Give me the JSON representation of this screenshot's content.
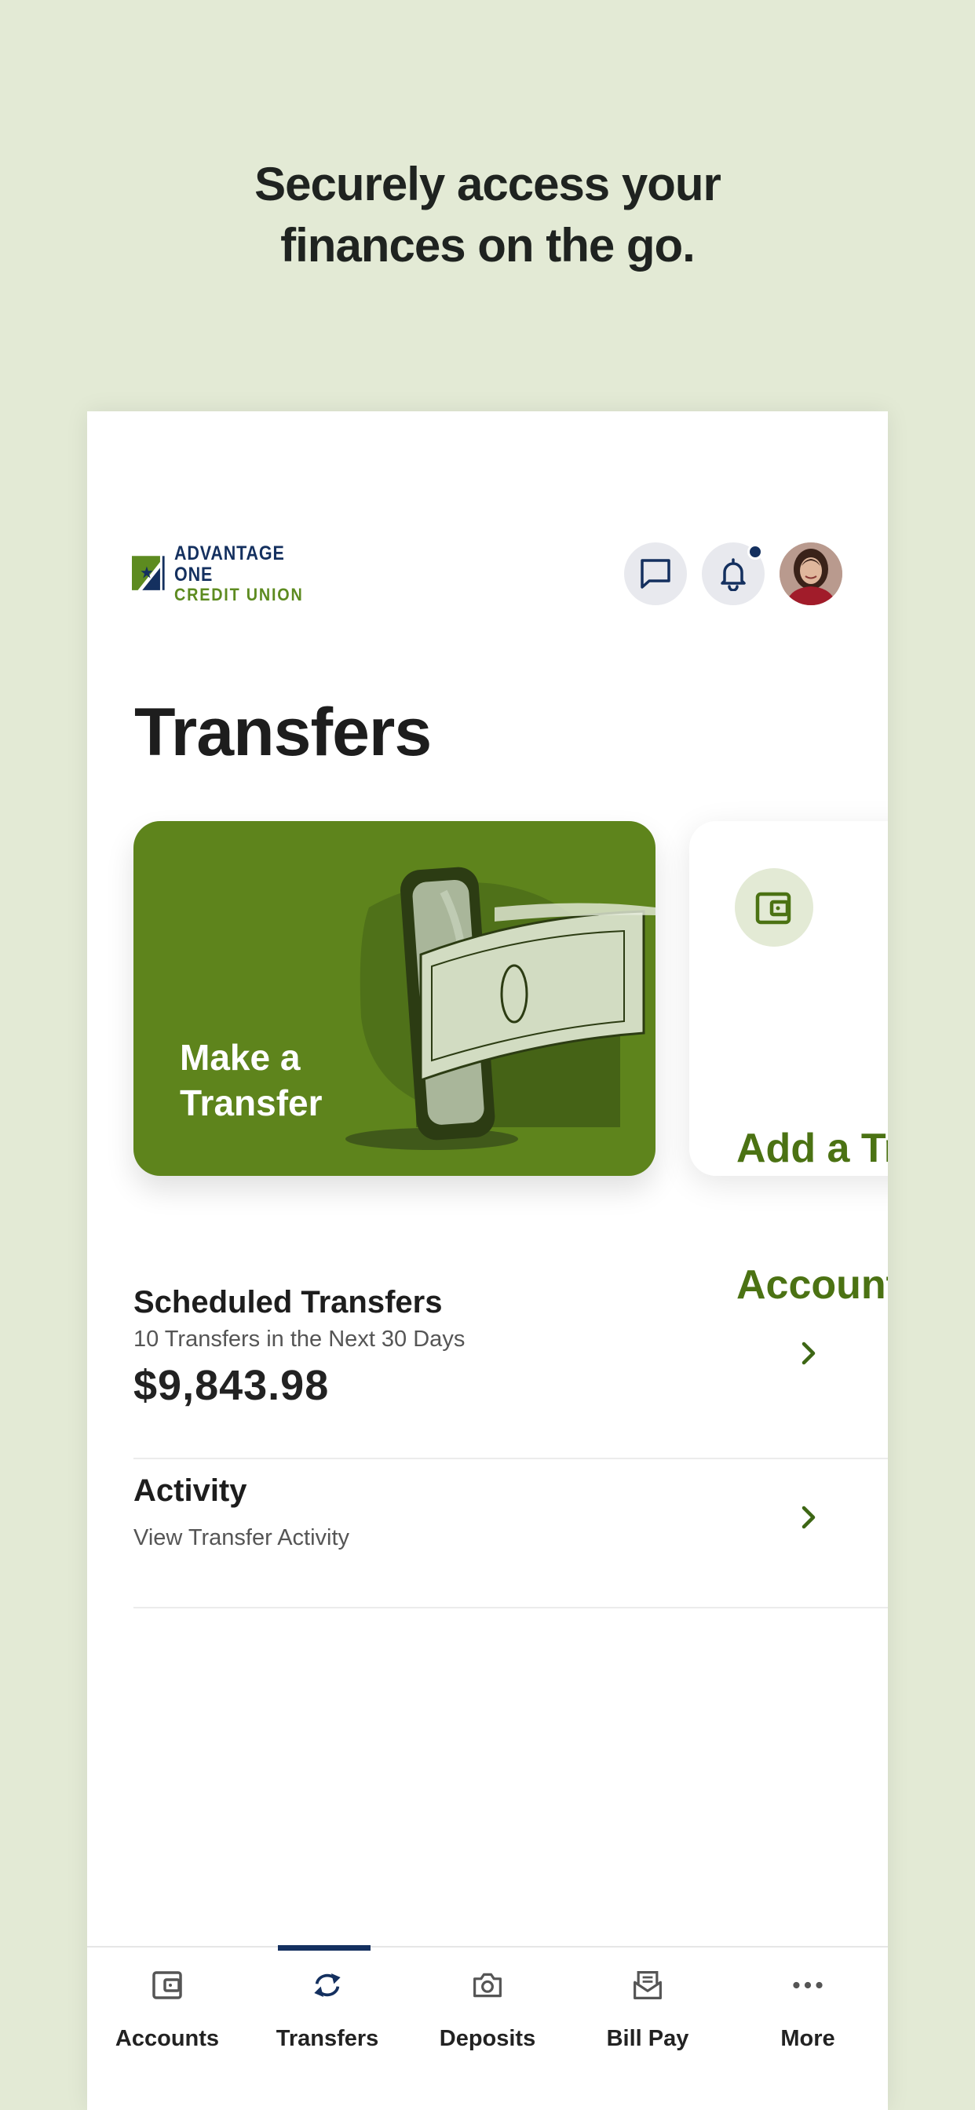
{
  "tagline": {
    "line1": "Securely access your",
    "line2": "finances on the go."
  },
  "brand": {
    "line1": "ADVANTAGE ONE",
    "line2": "CREDIT UNION",
    "colors": {
      "navy": "#14305f",
      "green": "#5d8b20"
    }
  },
  "header": {
    "icons": [
      "chat-icon",
      "bell-icon",
      "avatar"
    ],
    "notification_dot": true
  },
  "page": {
    "title": "Transfers"
  },
  "cards": [
    {
      "label": "Make a\nTransfer",
      "line1": "Make a",
      "line2": "Transfer",
      "color": "#5e841c"
    },
    {
      "label": "Add a Transfer Account",
      "line1": "Add a Tr",
      "line2": "Account",
      "icon": "wallet-icon"
    }
  ],
  "list": {
    "scheduled": {
      "title": "Scheduled Transfers",
      "subtitle": "10 Transfers in the Next 30 Days",
      "amount": "$9,843.98"
    },
    "activity": {
      "title": "Activity",
      "subtitle": "View Transfer Activity"
    }
  },
  "nav": {
    "active": "Transfers",
    "items": [
      {
        "label": "Accounts",
        "icon": "wallet-icon"
      },
      {
        "label": "Transfers",
        "icon": "transfer-icon"
      },
      {
        "label": "Deposits",
        "icon": "camera-icon"
      },
      {
        "label": "Bill Pay",
        "icon": "bill-icon"
      },
      {
        "label": "More",
        "icon": "more-icon"
      }
    ]
  }
}
